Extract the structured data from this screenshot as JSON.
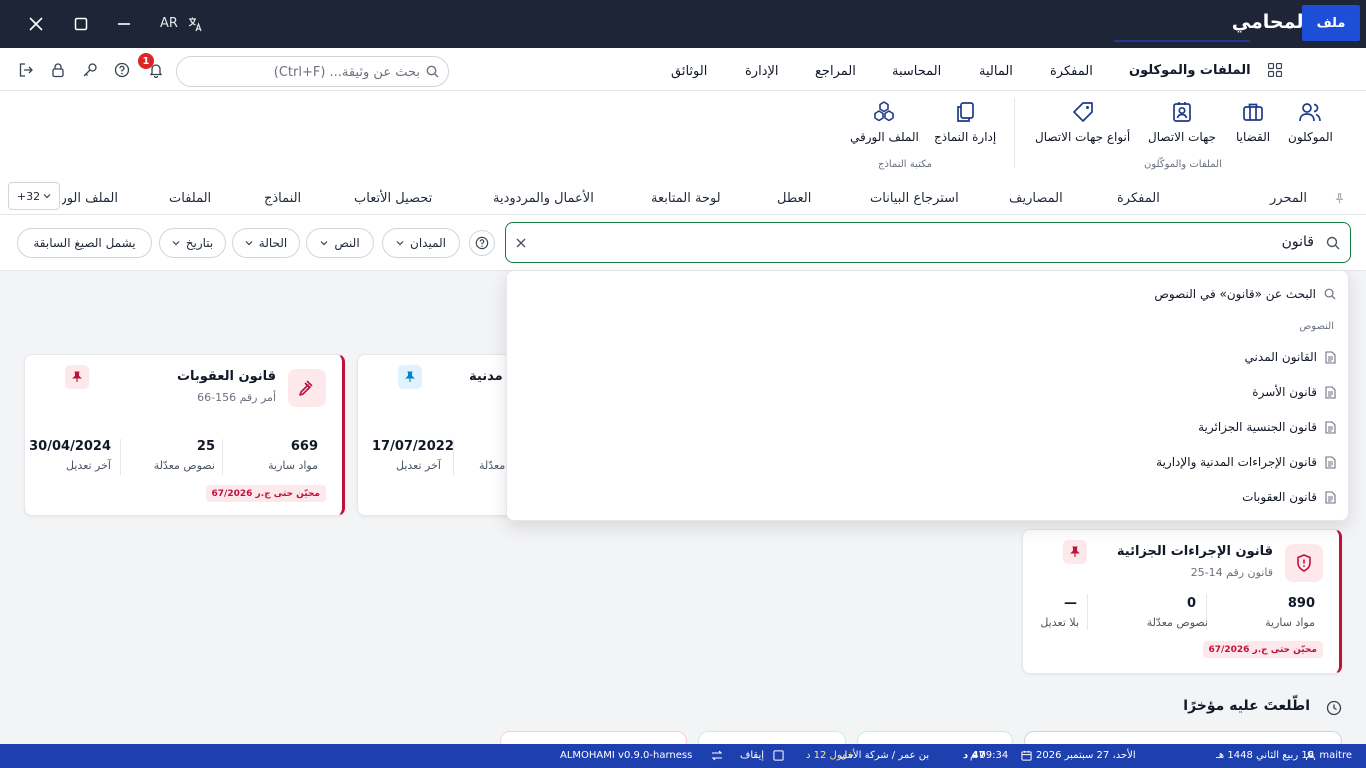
{
  "window": {
    "app_title": "المحامي",
    "lang": "AR",
    "colors": {
      "titlebar": "#1d2536",
      "accent": "#1d4ed8",
      "danger": "#be123c",
      "statusbar": "#1e40af"
    }
  },
  "menu": {
    "file_label": "ملف",
    "items": [
      "الملفات والموكلون",
      "المفكرة",
      "المالية",
      "المحاسبة",
      "المراجع",
      "الإدارة",
      "الوثائق"
    ],
    "search_placeholder": "بحث عن وثيقة... (Ctrl+F)",
    "notifications_count": "1"
  },
  "ribbon": {
    "group1_items": [
      "الموكلون",
      "القضايا",
      "جهات الاتصال",
      "أنواع جهات الاتصال"
    ],
    "group1_label": "الملفات والموكّلون",
    "group2_items": [
      "إدارة النماذج",
      "الملف الورقي"
    ],
    "group2_label": "مكتبة النماذج"
  },
  "tabs": {
    "items": [
      "المحرر",
      "المفكرة",
      "المصاريف",
      "استرجاع البيانات",
      "العطل",
      "لوحة المتابعة",
      "الأعمال والمردودية",
      "تحصيل الأتعاب",
      "النماذج",
      "الملفات",
      "الملف الور"
    ],
    "more_label": "+32"
  },
  "filters": {
    "search_value": "قانون",
    "chips": [
      "الميدان",
      "النص",
      "الحالة",
      "بتاريخ",
      "يشمل الصيغ السابقة"
    ]
  },
  "dropdown": {
    "search_in_texts": "البحث عن «قانون» في النصوص",
    "section_label": "النصوص",
    "results": [
      "القانون المدني",
      "قانون الأسرة",
      "قانون الجنسية الجزائرية",
      "قانون الإجراءات المدنية والإدارية",
      "قانون العقوبات"
    ]
  },
  "cards": [
    {
      "title": "قانون العقوبات",
      "subtitle": "أمر رقم 156-66",
      "stats": [
        {
          "value": "669",
          "label": "مواد سارية"
        },
        {
          "value": "25",
          "label": "نصوص معدّلة"
        },
        {
          "value": "30/04/2024",
          "label": "آخر تعديل"
        }
      ],
      "updated": "محيّن حتى ج.ر 67/2026"
    },
    {
      "title": "مدنية",
      "stats": [
        {
          "value": "17/07/2022",
          "label": "آخر تعديل"
        },
        {
          "label": "معدّلة"
        }
      ]
    },
    {
      "title": "قانون الإجراءات الجزائية",
      "subtitle": "قانون رقم 14-25",
      "stats": [
        {
          "value": "890",
          "label": "مواد سارية"
        },
        {
          "value": "0",
          "label": "نصوص معدّلة"
        },
        {
          "value": "—",
          "label": "بلا تعديل"
        }
      ],
      "updated": "محيّن حتى ج.ر 67/2026"
    }
  ],
  "recent": {
    "title": "اطّلعتَ عليه مؤخرًا"
  },
  "statusbar": {
    "user": "maitre",
    "date": "الأحد، 27 سبتمبر 2026",
    "hijri": "16 ربيع الثاني 1448 هـ",
    "time": "09:34 م",
    "org": "بن عمر / شركة الأمل",
    "sync": "47 د",
    "idle": "خمول 12 د",
    "pause": "إيقاف",
    "version": "ALMOHAMI v0.9.0-harness"
  }
}
